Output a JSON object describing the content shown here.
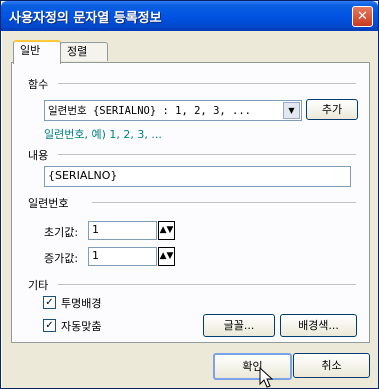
{
  "window": {
    "title": "사용자정의 문자열 등록정보",
    "close_icon": "close-icon"
  },
  "tabs": [
    {
      "label": "일반",
      "active": true
    },
    {
      "label": "정렬",
      "active": false
    }
  ],
  "function_section": {
    "label": "함수",
    "combo_value": "일련번호 {SERIALNO} : 1, 2, 3, ...",
    "add_button": "추가",
    "example": "일련번호, 예) 1, 2, 3, ..."
  },
  "content_section": {
    "label": "내용",
    "value": "{SERIALNO}"
  },
  "serial_section": {
    "label": "일련번호",
    "initial_label": "초기값:",
    "initial_value": "1",
    "increment_label": "증가값:",
    "increment_value": "1"
  },
  "other_section": {
    "label": "기타",
    "transparent_bg": {
      "label": "투명배경",
      "checked": true
    },
    "auto_fit": {
      "label": "자동맞춤",
      "checked": true
    },
    "font_button": "글꼴...",
    "bgcolor_button": "배경색..."
  },
  "footer": {
    "ok_button": "확인",
    "cancel_button": "취소"
  }
}
